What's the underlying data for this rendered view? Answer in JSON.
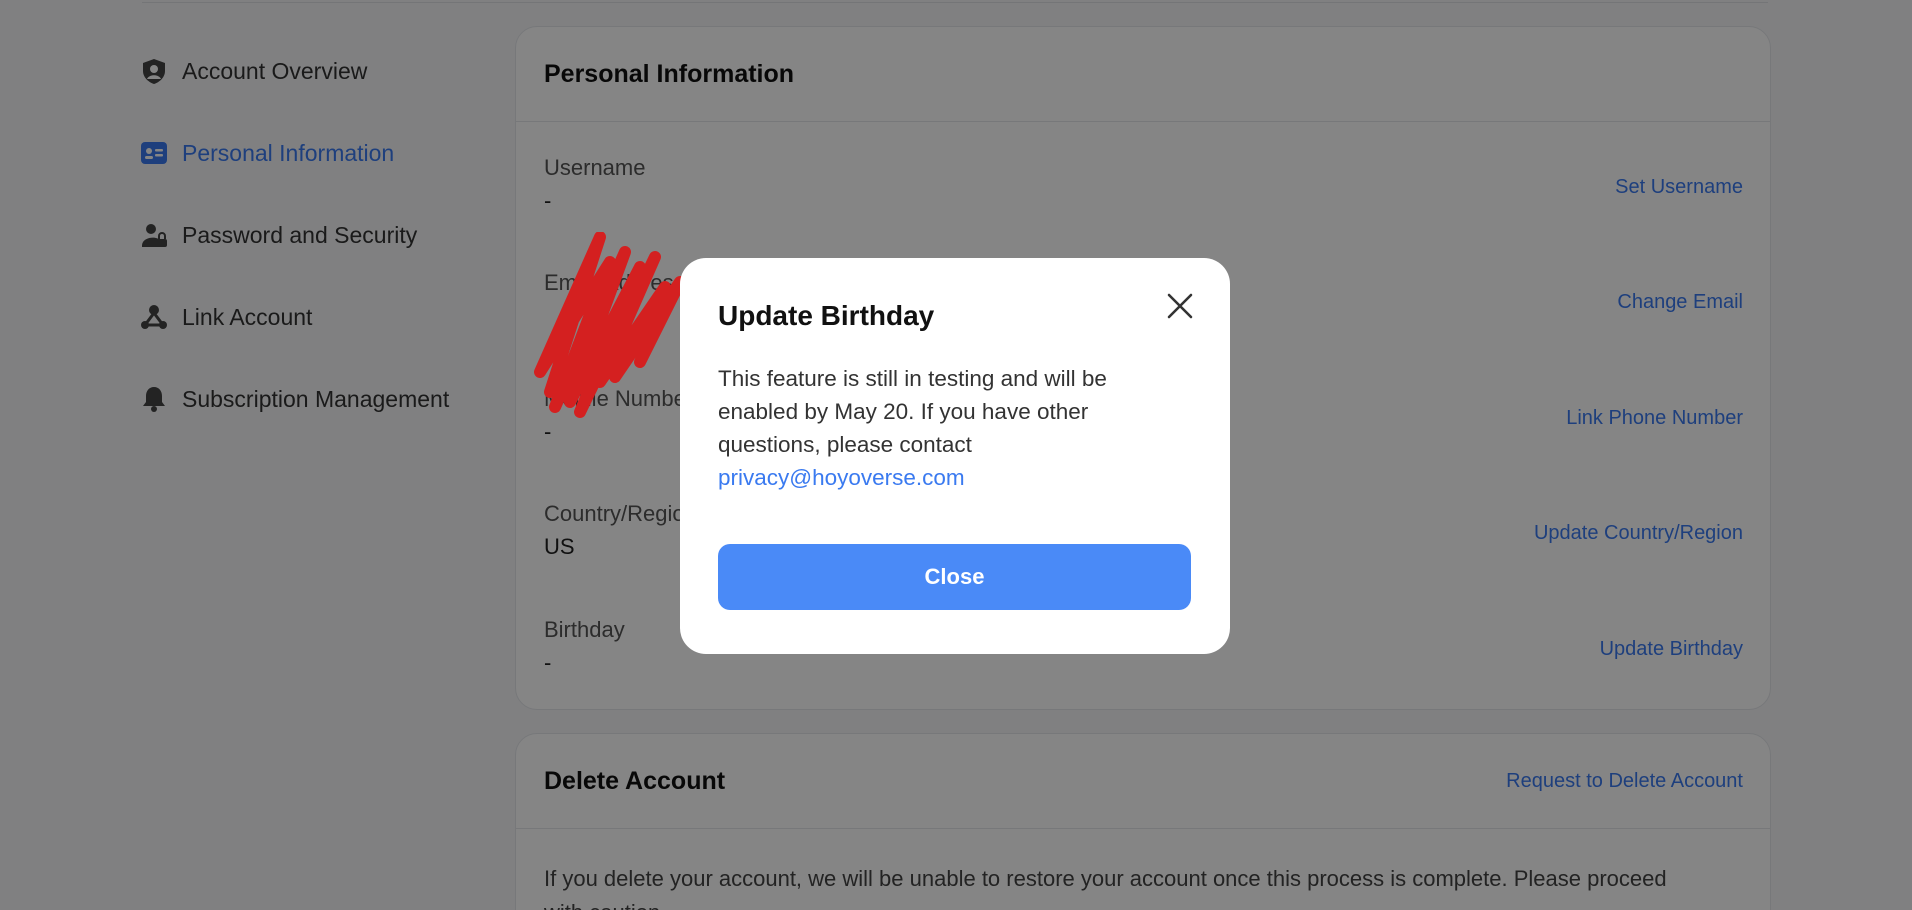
{
  "sidebar": {
    "items": [
      {
        "label": "Account Overview",
        "icon": "user-shield-icon"
      },
      {
        "label": "Personal Information",
        "icon": "id-card-icon",
        "active": true
      },
      {
        "label": "Password and Security",
        "icon": "lock-person-icon"
      },
      {
        "label": "Link Account",
        "icon": "link-nodes-icon"
      },
      {
        "label": "Subscription Management",
        "icon": "bell-icon"
      }
    ]
  },
  "personal_info": {
    "title": "Personal Information",
    "rows": [
      {
        "label": "Username",
        "value": "-",
        "action": "Set Username"
      },
      {
        "label": "Email Address",
        "value": "",
        "action": "Change Email"
      },
      {
        "label": "Mobile Number",
        "value": "-",
        "action": "Link Phone Number"
      },
      {
        "label": "Country/Region",
        "value": "US",
        "action": "Update Country/Region"
      },
      {
        "label": "Birthday",
        "value": "-",
        "action": "Update Birthday"
      }
    ]
  },
  "delete_account": {
    "title": "Delete Account",
    "action": "Request to Delete Account",
    "description": "If you delete your account, we will be unable to restore your account once this process is complete. Please proceed with caution."
  },
  "modal": {
    "title": "Update Birthday",
    "body": "This feature is still in testing and will be enabled by May 20. If you have other questions, please contact",
    "email": "privacy@hoyoverse.com",
    "close_label": "Close"
  },
  "colors": {
    "accent": "#3a7af0",
    "button": "#4a8af7",
    "redaction": "#d42020"
  }
}
